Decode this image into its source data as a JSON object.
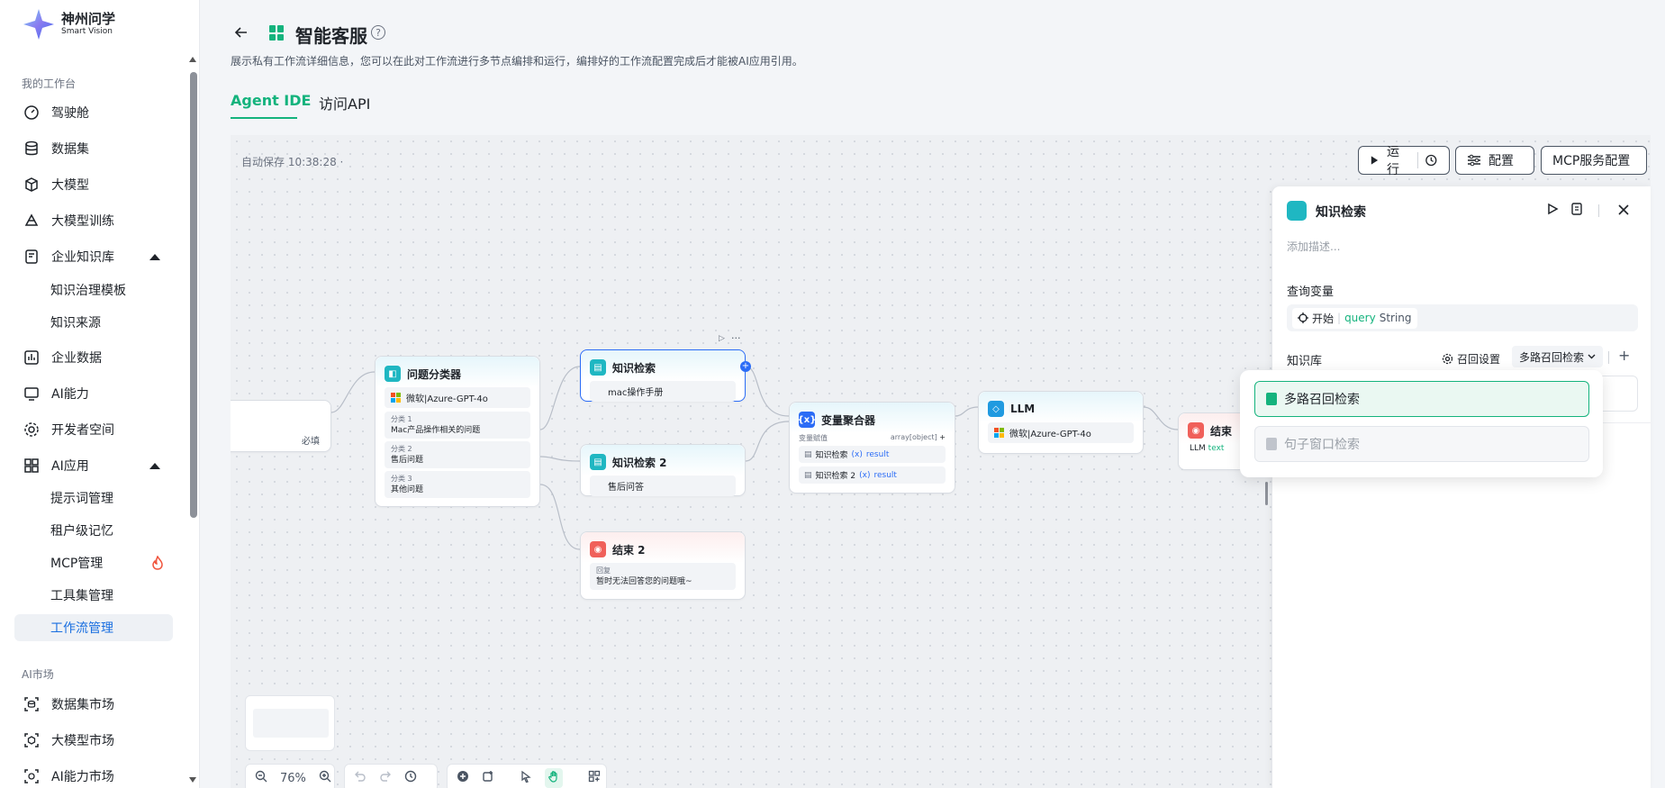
{
  "brand": {
    "name": "神州问学",
    "subname": "Smart Vision"
  },
  "sidebar": {
    "section1": "我的工作台",
    "items": [
      {
        "label": "驾驶舱"
      },
      {
        "label": "数据集"
      },
      {
        "label": "大模型"
      },
      {
        "label": "大模型训练"
      },
      {
        "label": "企业知识库"
      },
      {
        "label": "企业数据"
      },
      {
        "label": "AI能力"
      },
      {
        "label": "开发者空间"
      },
      {
        "label": "AI应用"
      }
    ],
    "kb_subs": [
      {
        "label": "知识治理模板"
      },
      {
        "label": "知识来源"
      }
    ],
    "app_subs": [
      {
        "label": "提示词管理"
      },
      {
        "label": "租户级记忆"
      },
      {
        "label": "MCP管理"
      },
      {
        "label": "工具集管理"
      },
      {
        "label": "工作流管理"
      }
    ],
    "section2": "AI市场",
    "market": [
      {
        "label": "数据集市场"
      },
      {
        "label": "大模型市场"
      },
      {
        "label": "AI能力市场"
      }
    ]
  },
  "header": {
    "title": "智能客服",
    "description": "展示私有工作流详细信息，您可以在此对工作流进行多节点编排和运行，编排好的工作流配置完成后才能被AI应用引用。",
    "tabs": [
      {
        "label": "Agent IDE"
      },
      {
        "label": "访问API"
      }
    ]
  },
  "canvas": {
    "autosave": "自动保存 10:38:28 ·",
    "toolbar": {
      "run": "运行",
      "config": "配置",
      "mcp": "MCP服务配置"
    },
    "zoom": "76%",
    "nodes": {
      "start_required": "必填",
      "classifier": {
        "title": "问题分类器",
        "model": "微软|Azure-GPT-4o",
        "classes": [
          {
            "label": "分类 1",
            "text": "Mac产品操作相关的问题"
          },
          {
            "label": "分类 2",
            "text": "售后问题"
          },
          {
            "label": "分类 3",
            "text": "其他问题"
          }
        ]
      },
      "kb1": {
        "title": "知识检索",
        "item": "mac操作手册"
      },
      "kb2": {
        "title": "知识检索 2",
        "item": "售后问答"
      },
      "end2": {
        "title": "结束 2",
        "label": "回复",
        "text": "暂时无法回答您的问题哦~"
      },
      "agg": {
        "title": "变量聚合器",
        "var_label": "变量赋值",
        "var_type": "array[object]",
        "rows": [
          {
            "src": "知识检索",
            "var": "result"
          },
          {
            "src": "知识检索 2",
            "var": "result"
          }
        ]
      },
      "llm": {
        "title": "LLM",
        "model": "微软|Azure-GPT-4o"
      },
      "end": {
        "title": "结束",
        "llm": "LLM",
        "var": "text"
      }
    }
  },
  "panel": {
    "title": "知识检索",
    "desc_placeholder": "添加描述...",
    "query_label": "查询变量",
    "query_src": "开始",
    "query_var": "query",
    "query_type": "String",
    "kb_label": "知识库",
    "recall_settings": "召回设置",
    "recall_mode": "多路召回检索",
    "options": [
      {
        "label": "多路召回检索"
      },
      {
        "label": "句子窗口检索"
      }
    ]
  }
}
